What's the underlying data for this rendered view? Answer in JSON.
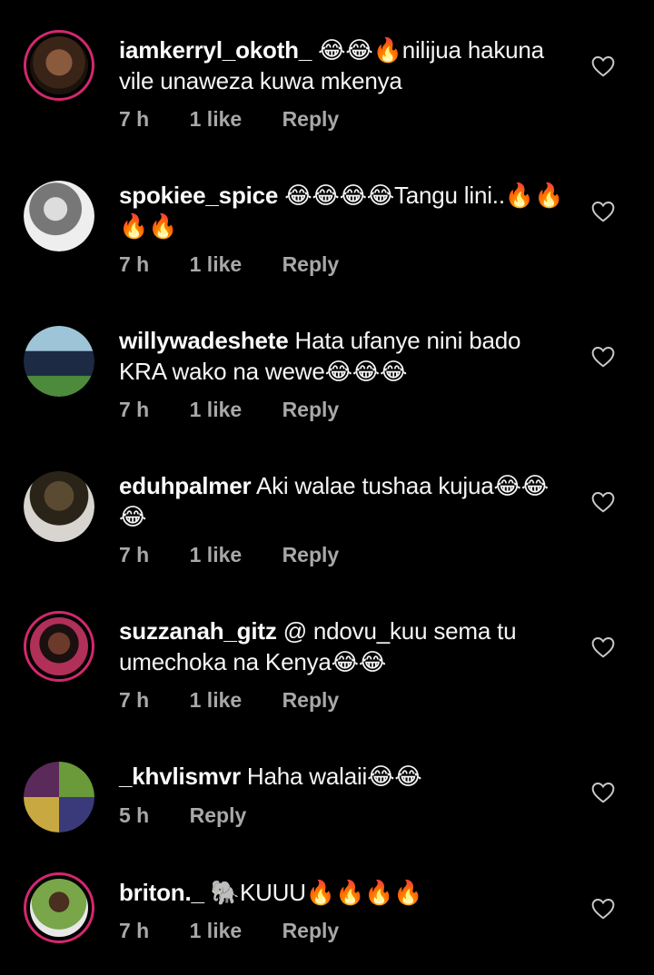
{
  "comments": [
    {
      "user": "iamkerryl_okoth_",
      "text": "😂😂🔥nilijua hakuna vile unaweza kuwa mkenya",
      "time": "7 h",
      "likes": "1 like",
      "reply": "Reply"
    },
    {
      "user": "spokiee_spice",
      "text": "😂😂😂😂Tangu lini..🔥🔥🔥🔥",
      "time": "7 h",
      "likes": "1 like",
      "reply": "Reply"
    },
    {
      "user": "willywadeshete",
      "text": "Hata ufanye nini bado KRA wako na wewe😂😂😂",
      "time": "7 h",
      "likes": "1 like",
      "reply": "Reply"
    },
    {
      "user": "eduhpalmer",
      "text": "Aki walae tushaa kujua😂😂😂",
      "time": "7 h",
      "likes": "1 like",
      "reply": "Reply"
    },
    {
      "user": "suzzanah_gitz",
      "text": "@ ndovu_kuu sema tu umechoka na Kenya😂😂",
      "time": "7 h",
      "likes": "1 like",
      "reply": "Reply"
    },
    {
      "user": "_khvlismvr",
      "text": "Haha walaii😂😂",
      "time": "5 h",
      "reply": "Reply"
    },
    {
      "user": "briton._",
      "text": "🐘KUUU🔥🔥🔥🔥",
      "time": "7 h",
      "likes": "1 like",
      "reply": "Reply"
    }
  ],
  "colors": {
    "background": "#000000",
    "story_ring": "#d3286e",
    "meta": "#a8a8a8"
  },
  "icons": {
    "like": "heart-outline-icon"
  }
}
